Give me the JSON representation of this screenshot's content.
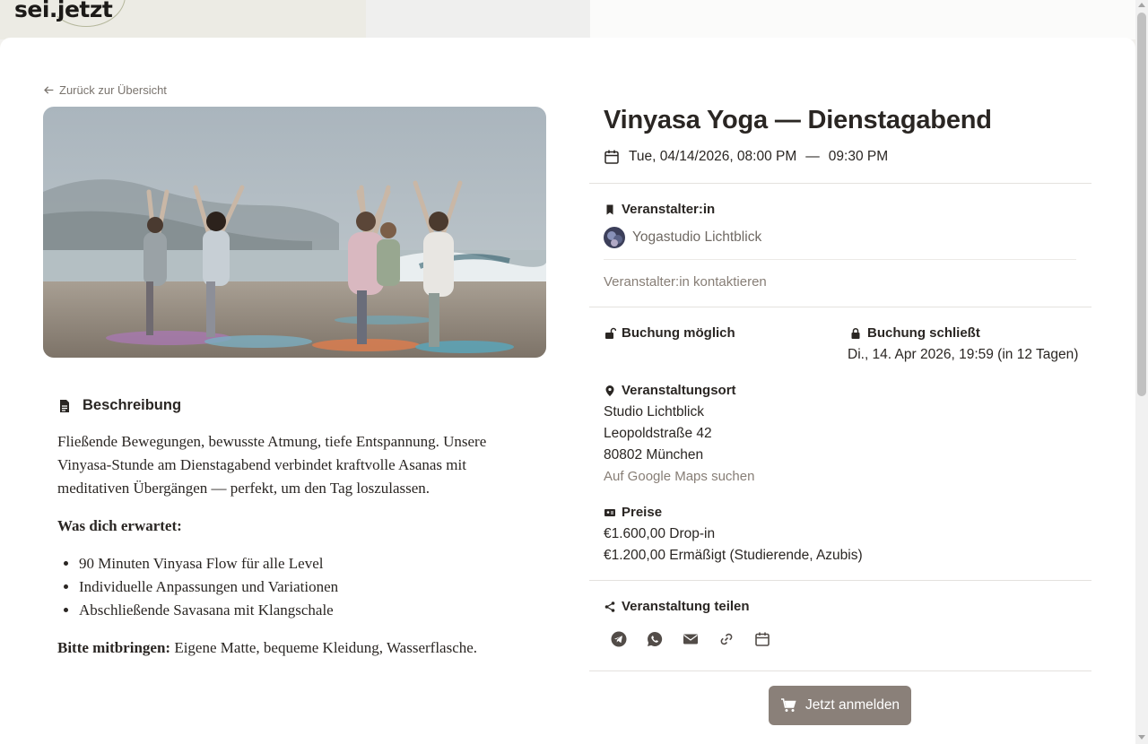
{
  "header": {
    "logo_text": "sei.jetzt"
  },
  "nav": {
    "back_label": "Zurück zur Übersicht"
  },
  "event": {
    "title": "Vinyasa Yoga — Dienstagabend",
    "date_start": "Tue, 04/14/2026, 08:00 PM",
    "date_separator": "—",
    "date_end": "09:30 PM"
  },
  "organizer": {
    "heading": "Veranstalter:in",
    "name": "Yogastudio Lichtblick",
    "contact_label": "Veranstalter:in kontaktieren"
  },
  "booking": {
    "open_label": "Buchung möglich",
    "closes_label": "Buchung schließt",
    "closes_value": "Di., 14. Apr 2026, 19:59 (in 12 Tagen)"
  },
  "venue": {
    "heading": "Veranstaltungsort",
    "name": "Studio Lichtblick",
    "street": "Leopoldstraße 42",
    "city": "80802 München",
    "maps_label": "Auf Google Maps suchen"
  },
  "prices": {
    "heading": "Preise",
    "items": [
      "€1.600,00 Drop-in",
      "€1.200,00 Ermäßigt (Studierende, Azubis)"
    ]
  },
  "share": {
    "heading": "Veranstaltung teilen",
    "icons": [
      "telegram-icon",
      "whatsapp-icon",
      "email-icon",
      "link-icon",
      "calendar-icon"
    ]
  },
  "cta": {
    "label": "Jetzt anmelden"
  },
  "description": {
    "heading": "Beschreibung",
    "intro": "Fließende Bewegungen, bewusste Atmung, tiefe Entspannung. Unsere Vinyasa-Stunde am Dienstagabend verbindet kraftvolle Asanas mit meditativen Übergängen — perfekt, um den Tag loszulassen.",
    "expect_heading": "Was dich erwartet:",
    "expect_items": [
      "90 Minuten Vinyasa Flow für alle Level",
      "Individuelle Anpassungen und Variationen",
      "Abschließende Savasana mit Klangschale"
    ],
    "bring_label": "Bitte mitbringen:",
    "bring_text": " Eigene Matte, bequeme Kleidung, Wasserflasche."
  },
  "colors": {
    "accent": "#8a8079",
    "link": "#877e76",
    "text": "#2a2623"
  }
}
